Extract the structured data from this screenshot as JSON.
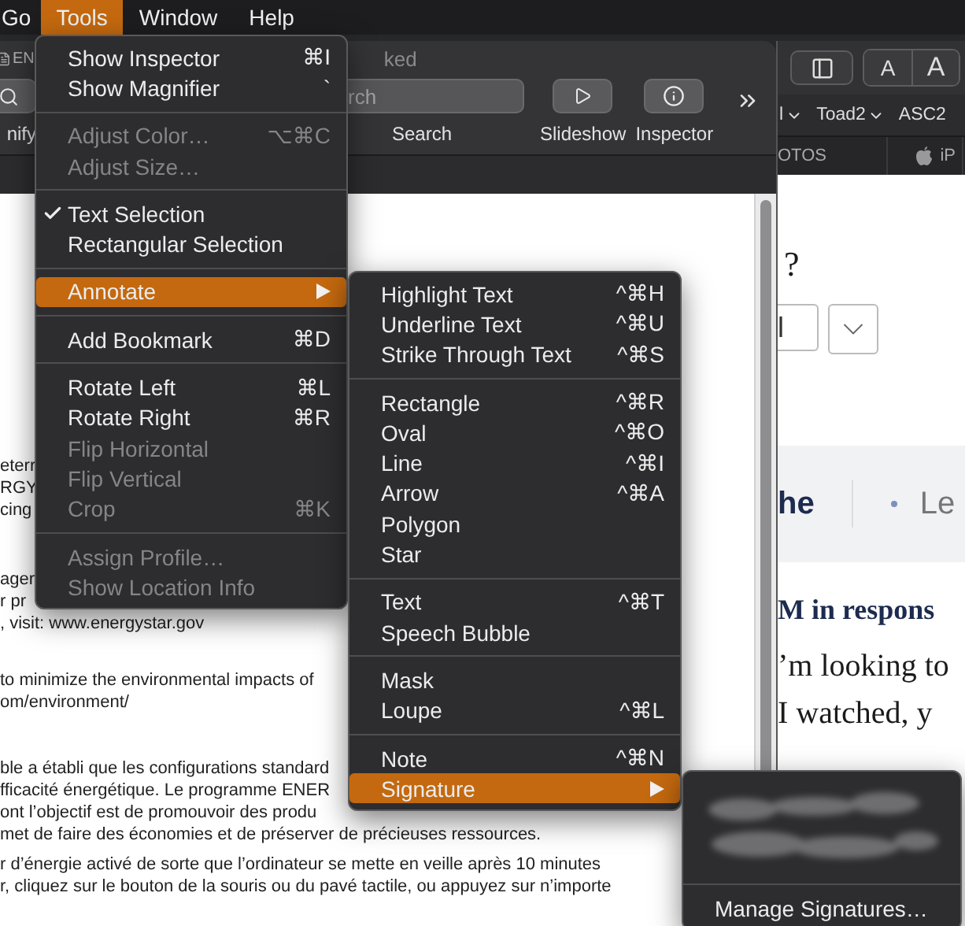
{
  "menu_bar": {
    "items": [
      {
        "label": "Go",
        "selected": false
      },
      {
        "label": "Tools",
        "selected": true
      },
      {
        "label": "Window",
        "selected": false
      },
      {
        "label": "Help",
        "selected": false
      }
    ]
  },
  "preview_window": {
    "title": "EN",
    "title_tail": "ked",
    "toolbar": [
      {
        "kind": "button",
        "label": "nify"
      },
      {
        "kind": "search",
        "placeholder": "rch",
        "label": "Search"
      },
      {
        "kind": "slideshow",
        "label": "Slideshow"
      },
      {
        "kind": "inspector",
        "label": "Inspector"
      }
    ],
    "document": [
      [
        "eterr",
        "RGY",
        "cing"
      ],
      [
        "ager",
        "r pr",
        ", visit: www.energystar.gov"
      ],
      [
        "to minimize the environmental impacts of",
        "om/environment/"
      ],
      [
        "ble a établi que les configurations standard",
        "fficacité énergétique. Le programme ENER",
        "ont l’objectif est de promouvoir des produ",
        "met de faire des économies et de préserver de précieuses ressources."
      ],
      [
        "r d’énergie activé de sorte que l’ordinateur se mette en veille après 10 minutes",
        "r, cliquez sur le bouton de la souris ou du pavé tactile, ou appuyez sur n’importe"
      ]
    ]
  },
  "browser_window": {
    "text_size_buttons": [
      "A",
      "A"
    ],
    "bookmarks": [
      {
        "label": "l",
        "menu": true
      },
      {
        "label": "Toad2",
        "menu": true
      },
      {
        "label": "ASC2",
        "menu": false
      }
    ],
    "tabs": [
      {
        "label": "OTOS",
        "apple": false,
        "selected": false
      },
      {
        "label": "iP",
        "apple": true,
        "selected": false
      }
    ],
    "question": "?",
    "select_value": "l",
    "nav": [
      {
        "label": "he",
        "selected": true
      },
      {
        "label": "Le",
        "selected": false
      }
    ],
    "heading": "M in respons",
    "paragraph": [
      "’m looking to",
      "I watched, y"
    ]
  },
  "tools_menu": {
    "items": [
      {
        "kind": "item",
        "label": "Show Inspector",
        "shortcut": "⌘I",
        "disabled": false,
        "checked": false,
        "selected": false,
        "submenu": false
      },
      {
        "kind": "item",
        "label": "Show Magnifier",
        "shortcut": "`",
        "disabled": false,
        "checked": false,
        "selected": false,
        "submenu": false
      },
      {
        "kind": "separator"
      },
      {
        "kind": "item",
        "label": "Adjust Color…",
        "shortcut": "⌥⌘C",
        "disabled": true,
        "checked": false,
        "selected": false,
        "submenu": false
      },
      {
        "kind": "item",
        "label": "Adjust Size…",
        "disabled": true,
        "checked": false,
        "selected": false,
        "submenu": false
      },
      {
        "kind": "separator"
      },
      {
        "kind": "item",
        "label": "Text Selection",
        "disabled": false,
        "checked": true,
        "selected": false,
        "submenu": false
      },
      {
        "kind": "item",
        "label": "Rectangular Selection",
        "disabled": false,
        "checked": false,
        "selected": false,
        "submenu": false
      },
      {
        "kind": "separator"
      },
      {
        "kind": "item",
        "label": "Annotate",
        "disabled": false,
        "checked": false,
        "selected": true,
        "submenu": true
      },
      {
        "kind": "separator"
      },
      {
        "kind": "item",
        "label": "Add Bookmark",
        "shortcut": "⌘D",
        "disabled": false,
        "checked": false,
        "selected": false,
        "submenu": false
      },
      {
        "kind": "separator"
      },
      {
        "kind": "item",
        "label": "Rotate Left",
        "shortcut": "⌘L",
        "disabled": false,
        "checked": false,
        "selected": false,
        "submenu": false
      },
      {
        "kind": "item",
        "label": "Rotate Right",
        "shortcut": "⌘R",
        "disabled": false,
        "checked": false,
        "selected": false,
        "submenu": false
      },
      {
        "kind": "item",
        "label": "Flip Horizontal",
        "disabled": true,
        "checked": false,
        "selected": false,
        "submenu": false
      },
      {
        "kind": "item",
        "label": "Flip Vertical",
        "disabled": true,
        "checked": false,
        "selected": false,
        "submenu": false
      },
      {
        "kind": "item",
        "label": "Crop",
        "shortcut": "⌘K",
        "disabled": true,
        "checked": false,
        "selected": false,
        "submenu": false
      },
      {
        "kind": "separator"
      },
      {
        "kind": "item",
        "label": "Assign Profile…",
        "disabled": true,
        "checked": false,
        "selected": false,
        "submenu": false
      },
      {
        "kind": "item",
        "label": "Show Location Info",
        "disabled": true,
        "checked": false,
        "selected": false,
        "submenu": false
      }
    ]
  },
  "annotate_menu": {
    "items": [
      {
        "kind": "item",
        "label": "Highlight Text",
        "shortcut": "^⌘H",
        "selected": false,
        "submenu": false
      },
      {
        "kind": "item",
        "label": "Underline Text",
        "shortcut": "^⌘U",
        "selected": false,
        "submenu": false
      },
      {
        "kind": "item",
        "label": "Strike Through Text",
        "shortcut": "^⌘S",
        "selected": false,
        "submenu": false
      },
      {
        "kind": "separator"
      },
      {
        "kind": "item",
        "label": "Rectangle",
        "shortcut": "^⌘R",
        "selected": false,
        "submenu": false
      },
      {
        "kind": "item",
        "label": "Oval",
        "shortcut": "^⌘O",
        "selected": false,
        "submenu": false
      },
      {
        "kind": "item",
        "label": "Line",
        "shortcut": "^⌘I",
        "selected": false,
        "submenu": false
      },
      {
        "kind": "item",
        "label": "Arrow",
        "shortcut": "^⌘A",
        "selected": false,
        "submenu": false
      },
      {
        "kind": "item",
        "label": "Polygon",
        "selected": false,
        "submenu": false
      },
      {
        "kind": "item",
        "label": "Star",
        "selected": false,
        "submenu": false
      },
      {
        "kind": "separator"
      },
      {
        "kind": "item",
        "label": "Text",
        "shortcut": "^⌘T",
        "selected": false,
        "submenu": false
      },
      {
        "kind": "item",
        "label": "Speech Bubble",
        "selected": false,
        "submenu": false
      },
      {
        "kind": "separator"
      },
      {
        "kind": "item",
        "label": "Mask",
        "selected": false,
        "submenu": false
      },
      {
        "kind": "item",
        "label": "Loupe",
        "shortcut": "^⌘L",
        "selected": false,
        "submenu": false
      },
      {
        "kind": "separator"
      },
      {
        "kind": "item",
        "label": "Note",
        "shortcut": "^⌘N",
        "selected": false,
        "submenu": false
      },
      {
        "kind": "item",
        "label": "Signature",
        "selected": true,
        "submenu": true
      }
    ]
  },
  "signature_menu": {
    "items": [
      {
        "kind": "signature"
      },
      {
        "kind": "separator"
      },
      {
        "kind": "item",
        "label": "Manage Signatures…",
        "selected": false,
        "submenu": false
      }
    ]
  }
}
